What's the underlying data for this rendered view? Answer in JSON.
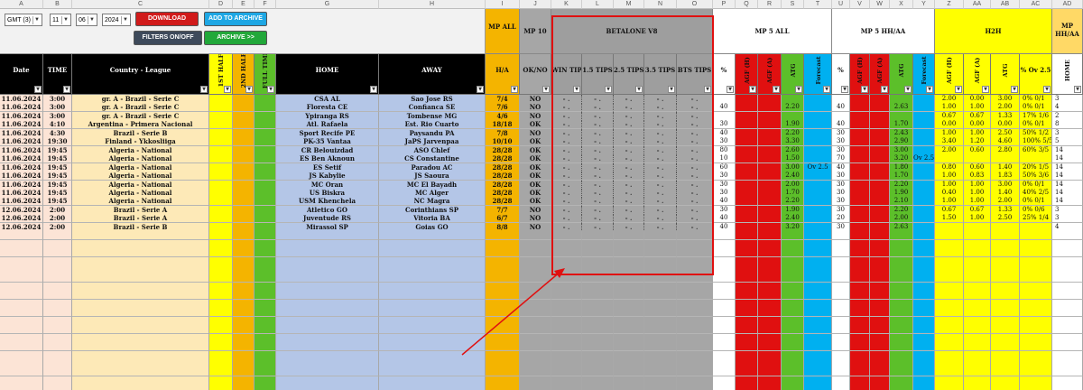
{
  "column_letters": [
    "A",
    "B",
    "C",
    "D",
    "E",
    "F",
    "G",
    "H",
    "I",
    "J",
    "K",
    "L",
    "M",
    "N",
    "O",
    "P",
    "Q",
    "R",
    "S",
    "T",
    "U",
    "V",
    "W",
    "X",
    "Y",
    "Z",
    "AA",
    "AB",
    "AC",
    "AD"
  ],
  "toolbar": {
    "timezone": "GMT (3)",
    "day": "11",
    "month": "06",
    "year": "2024",
    "download_label": "DOWNLOAD",
    "add_archive_label": "ADD TO ARCHIVE",
    "filters_label": "FILTERS ON/OFF",
    "archive_label": "ARCHIVE >>"
  },
  "headers": {
    "mp_all": "MP ALL",
    "mp10": "MP 10",
    "betalone": "BETALONE V8",
    "mp5_all": "MP 5 ALL",
    "mp5_hhaa": "MP 5 HH/AA",
    "h2h": "H2H",
    "mp_hhaa": "MP HH/AA",
    "date": "Date",
    "time": "TIME",
    "country_league": "Country - League",
    "first_half": "1ST HALF",
    "second_half": "2ND HALF",
    "full_time": "FULL TIME",
    "home": "HOME",
    "away": "AWAY",
    "ha": "H/A",
    "okno": "OK/NO",
    "win_tips": "WIN TIPS",
    "tips15": "1.5 TIPS",
    "tips25": "2.5 TIPS",
    "tips35": "3.5 TIPS",
    "bts_tips": "BTS TIPS",
    "pct": "%",
    "agf_h": "AGF (H)",
    "agf_a": "AGF (A)",
    "atg": "ATG",
    "forecast": "Forecast",
    "pct_ov25": "% Ov 2.5",
    "home_short": "HOME",
    "away_short": "AWAY"
  },
  "rows": [
    {
      "date": "11.06.2024",
      "time": "3:00",
      "league": "gr. A - Brazil - Serie C",
      "home": "CSA AL",
      "away": "Sao Jose RS",
      "ha": "7/4",
      "ok": "NO",
      "p_pct": "",
      "s_atg": "",
      "u_pct": "",
      "x_atg": "",
      "y_fc": "",
      "t_fc": "",
      "z": "2.00",
      "aa": "0.00",
      "ab": "3.00",
      "ac": "0%  0/1",
      "ad": "3"
    },
    {
      "date": "11.06.2024",
      "time": "3:00",
      "league": "gr. A - Brazil - Serie C",
      "home": "Floresta CE",
      "away": "Confianca SE",
      "ha": "7/6",
      "ok": "NO",
      "p_pct": "40",
      "s_atg": "2.20",
      "u_pct": "40",
      "x_atg": "2.63",
      "y_fc": "",
      "t_fc": "",
      "z": "1.00",
      "aa": "1.00",
      "ab": "2.00",
      "ac": "0%  0/1",
      "ad": "4"
    },
    {
      "date": "11.06.2024",
      "time": "3:00",
      "league": "gr. A - Brazil - Serie C",
      "home": "Ypiranga RS",
      "away": "Tombense MG",
      "ha": "4/6",
      "ok": "NO",
      "p_pct": "",
      "s_atg": "",
      "u_pct": "",
      "x_atg": "",
      "y_fc": "",
      "t_fc": "",
      "z": "0.67",
      "aa": "0.67",
      "ab": "1.33",
      "ac": "17%  1/6",
      "ad": "2"
    },
    {
      "date": "11.06.2024",
      "time": "4:10",
      "league": "Argentina - Primera Nacional",
      "home": "Atl. Rafaela",
      "away": "Est. Rio Cuarto",
      "ha": "18/18",
      "ok": "OK",
      "p_pct": "30",
      "s_atg": "1.90",
      "u_pct": "40",
      "x_atg": "1.70",
      "y_fc": "",
      "t_fc": "",
      "z": "0.00",
      "aa": "0.00",
      "ab": "0.00",
      "ac": "0%  0/1",
      "ad": "8"
    },
    {
      "date": "11.06.2024",
      "time": "4:30",
      "league": "Brazil - Serie B",
      "home": "Sport Recife PE",
      "away": "Paysandu PA",
      "ha": "7/8",
      "ok": "NO",
      "p_pct": "40",
      "s_atg": "2.20",
      "u_pct": "30",
      "x_atg": "2.43",
      "y_fc": "",
      "t_fc": "",
      "z": "1.00",
      "aa": "1.00",
      "ab": "2.50",
      "ac": "50%  1/2",
      "ad": "3"
    },
    {
      "date": "11.06.2024",
      "time": "19:30",
      "league": "Finland - Ykkosliiga",
      "home": "PK-35 Vantaa",
      "away": "JaPS Jarvenpaa",
      "ha": "10/10",
      "ok": "OK",
      "p_pct": "30",
      "s_atg": "3.30",
      "u_pct": "30",
      "x_atg": "2.90",
      "y_fc": "",
      "t_fc": "",
      "z": "3.40",
      "aa": "1.20",
      "ab": "4.60",
      "ac": "100%  5/5",
      "ad": "5"
    },
    {
      "date": "11.06.2024",
      "time": "19:45",
      "league": "Algeria - National",
      "home": "CR Belouizdad",
      "away": "ASO Chlef",
      "ha": "28/28",
      "ok": "OK",
      "p_pct": "80",
      "s_atg": "2.60",
      "u_pct": "30",
      "x_atg": "3.00",
      "y_fc": "",
      "t_fc": "",
      "z": "2.00",
      "aa": "0.60",
      "ab": "2.80",
      "ac": "60%  3/5",
      "ad": "14"
    },
    {
      "date": "11.06.2024",
      "time": "19:45",
      "league": "Algeria - National",
      "home": "ES Ben Aknoun",
      "away": "CS Constantine",
      "ha": "28/28",
      "ok": "OK",
      "p_pct": "10",
      "s_atg": "1.50",
      "u_pct": "70",
      "x_atg": "3.20",
      "y_fc": "Ov 2.5",
      "t_fc": "",
      "z": "",
      "aa": "",
      "ab": "",
      "ac": "",
      "ad": "14"
    },
    {
      "date": "11.06.2024",
      "time": "19:45",
      "league": "Algeria - National",
      "home": "ES Setif",
      "away": "Paradou AC",
      "ha": "28/28",
      "ok": "OK",
      "p_pct": "60",
      "s_atg": "3.00",
      "u_pct": "40",
      "x_atg": "1.80",
      "y_fc": "",
      "t_fc": "Ov 2.5",
      "z": "0.80",
      "aa": "0.60",
      "ab": "1.40",
      "ac": "20%  1/5",
      "ad": "14"
    },
    {
      "date": "11.06.2024",
      "time": "19:45",
      "league": "Algeria - National",
      "home": "JS Kabylie",
      "away": "JS Saoura",
      "ha": "28/28",
      "ok": "OK",
      "p_pct": "30",
      "s_atg": "2.40",
      "u_pct": "30",
      "x_atg": "1.70",
      "y_fc": "",
      "t_fc": "",
      "z": "1.00",
      "aa": "0.83",
      "ab": "1.83",
      "ac": "50%  3/6",
      "ad": "14"
    },
    {
      "date": "11.06.2024",
      "time": "19:45",
      "league": "Algeria - National",
      "home": "MC Oran",
      "away": "MC El Bayadh",
      "ha": "28/28",
      "ok": "OK",
      "p_pct": "30",
      "s_atg": "2.00",
      "u_pct": "30",
      "x_atg": "2.20",
      "y_fc": "",
      "t_fc": "",
      "z": "1.00",
      "aa": "1.00",
      "ab": "3.00",
      "ac": "0%  0/1",
      "ad": "14"
    },
    {
      "date": "11.06.2024",
      "time": "19:45",
      "league": "Algeria - National",
      "home": "US Biskra",
      "away": "MC Alger",
      "ha": "28/28",
      "ok": "OK",
      "p_pct": "30",
      "s_atg": "1.70",
      "u_pct": "30",
      "x_atg": "1.90",
      "y_fc": "",
      "t_fc": "",
      "z": "0.40",
      "aa": "1.00",
      "ab": "1.40",
      "ac": "40%  2/5",
      "ad": "14"
    },
    {
      "date": "11.06.2024",
      "time": "19:45",
      "league": "Algeria - National",
      "home": "USM Khenchela",
      "away": "NC Magra",
      "ha": "28/28",
      "ok": "OK",
      "p_pct": "40",
      "s_atg": "2.20",
      "u_pct": "30",
      "x_atg": "2.10",
      "y_fc": "",
      "t_fc": "",
      "z": "1.00",
      "aa": "1.00",
      "ab": "2.00",
      "ac": "0%  0/1",
      "ad": "14"
    },
    {
      "date": "12.06.2024",
      "time": "2:00",
      "league": "Brazil - Serie A",
      "home": "Atletico GO",
      "away": "Corinthians SP",
      "ha": "7/7",
      "ok": "NO",
      "p_pct": "30",
      "s_atg": "1.90",
      "u_pct": "30",
      "x_atg": "2.20",
      "y_fc": "",
      "t_fc": "",
      "z": "0.67",
      "aa": "0.67",
      "ab": "1.33",
      "ac": "0%  0/6",
      "ad": "3"
    },
    {
      "date": "12.06.2024",
      "time": "2:00",
      "league": "Brazil - Serie A",
      "home": "Juventude RS",
      "away": "Vitoria BA",
      "ha": "6/7",
      "ok": "NO",
      "p_pct": "40",
      "s_atg": "2.40",
      "u_pct": "20",
      "x_atg": "2.00",
      "y_fc": "",
      "t_fc": "",
      "z": "1.50",
      "aa": "1.00",
      "ab": "2.50",
      "ac": "25%  1/4",
      "ad": "3"
    },
    {
      "date": "12.06.2024",
      "time": "2:00",
      "league": "Brazil - Serie B",
      "home": "Mirassol SP",
      "away": "Goias GO",
      "ha": "8/8",
      "ok": "NO",
      "p_pct": "40",
      "s_atg": "3.20",
      "u_pct": "30",
      "x_atg": "2.63",
      "y_fc": "",
      "t_fc": "",
      "z": "",
      "aa": "",
      "ab": "",
      "ac": "",
      "ad": "4"
    }
  ],
  "colors": {
    "accent_red": "#e01010",
    "header_yellow": "#ffd966",
    "mp_all_orange": "#f4b400",
    "gray": "#a6a6a6",
    "blue": "#1fa3e0",
    "green": "#5cbf2a",
    "cyan": "#00b0f0",
    "yellow": "#ffff00",
    "black": "#000000",
    "league_tan": "#fde9b7",
    "team_blue": "#b4c6e7",
    "date_pink": "#fce4d6"
  }
}
